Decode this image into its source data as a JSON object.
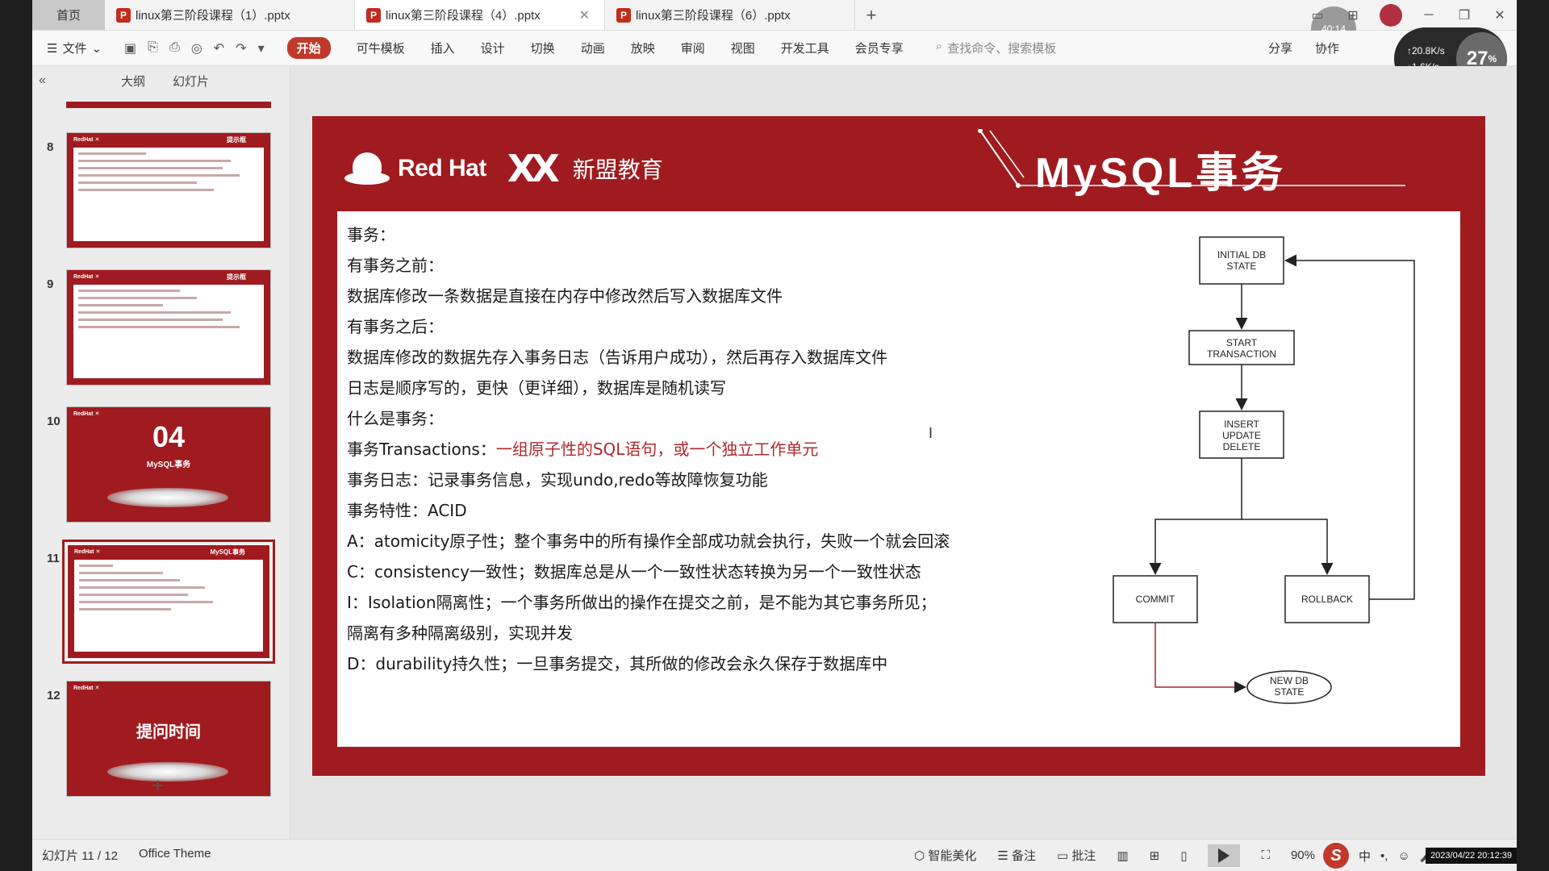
{
  "tabbar": {
    "home": "首页",
    "tabs": [
      {
        "label": "linux第三阶段课程（1）.pptx",
        "active": false
      },
      {
        "label": "linux第三阶段课程（4）.pptx",
        "active": true
      },
      {
        "label": "linux第三阶段课程（6）.pptx",
        "active": false
      }
    ],
    "add": "+",
    "timer": "40:14"
  },
  "ribbon": {
    "file_menu": "文件",
    "tabs": [
      "开始",
      "可牛模板",
      "插入",
      "设计",
      "切换",
      "动画",
      "放映",
      "审阅",
      "视图",
      "开发工具",
      "会员专享"
    ],
    "active_tab": "开始",
    "search_placeholder": "查找命令、搜索模板",
    "collab": "协作",
    "share": "分享",
    "upload_speed": "↑20.8K/s",
    "download_speed": "↓1.6K/s",
    "cpu_percent": "27",
    "cpu_unit": "%"
  },
  "left_panel": {
    "tab_outline": "大纲",
    "tab_slides": "幻灯片",
    "thumbnails": [
      {
        "number": "8",
        "tag": "提示框"
      },
      {
        "number": "9",
        "tag": "提示框"
      },
      {
        "number": "10",
        "big": "04",
        "sub": "MySQL事务"
      },
      {
        "number": "11",
        "tag": "MySQL事务"
      },
      {
        "number": "12",
        "big": "提问时间"
      }
    ],
    "add": "+"
  },
  "slide": {
    "brand_redhat": "Red Hat",
    "brand_xm": "新盟教育",
    "title": "MySQL事务",
    "lines": [
      {
        "text": "事务："
      },
      {
        "text": "有事务之前："
      },
      {
        "text": "数据库修改一条数据是直接在内存中修改然后写入数据库文件"
      },
      {
        "text": "有事务之后："
      },
      {
        "text": "数据库修改的数据先存入事务日志（告诉用户成功），然后再存入数据库文件"
      },
      {
        "text": "日志是顺序写的，更快（更详细），数据库是随机读写"
      },
      {
        "text": "什么是事务："
      },
      {
        "text": "事务Transactions：",
        "red": "一组原子性的SQL语句，或一个独立工作单元"
      },
      {
        "text": "事务日志：记录事务信息，实现undo,redo等故障恢复功能"
      },
      {
        "text": "事务特性：ACID"
      },
      {
        "text": "A：atomicity原子性；整个事务中的所有操作全部成功就会执行，失败一个就会回滚"
      },
      {
        "text": "C：consistency一致性；数据库总是从一个一致性状态转换为另一个一致性状态"
      },
      {
        "text": "I：Isolation隔离性；一个事务所做出的操作在提交之前，是不能为其它事务所见；"
      },
      {
        "text": "隔离有多种隔离级别，实现并发"
      },
      {
        "text": "D：durability持久性；一旦事务提交，其所做的修改会永久保存于数据库中"
      }
    ],
    "flow": {
      "initial_l1": "INITIAL DB",
      "initial_l2": "STATE",
      "start_l1": "START",
      "start_l2": "TRANSACTION",
      "insert": "INSERT",
      "update": "UPDATE",
      "delete": "DELETE",
      "commit": "COMMIT",
      "rollback": "ROLLBACK",
      "new_l1": "NEW DB",
      "new_l2": "STATE"
    }
  },
  "statusbar": {
    "slide_info": "幻灯片 11 / 12",
    "theme": "Office Theme",
    "beautify": "智能美化",
    "notes": "备注",
    "comment": "批注",
    "zoom": "90%",
    "ime": "中",
    "datetime": "2023/04/22 20:12:39"
  },
  "colors": {
    "slide_red": "#a01b1f",
    "accent_red": "#c0392b",
    "highlight_text": "#b0282c"
  }
}
